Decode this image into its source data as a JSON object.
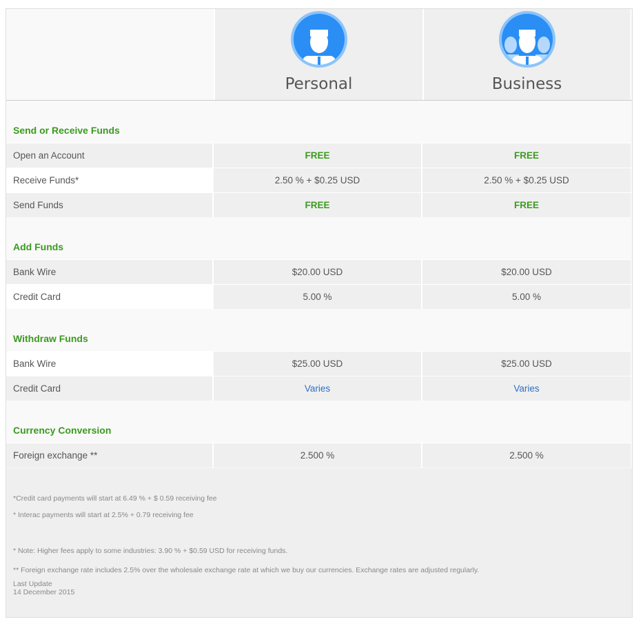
{
  "plans": [
    {
      "name": "Personal",
      "icon": "person-icon"
    },
    {
      "name": "Business",
      "icon": "group-icon"
    }
  ],
  "colors": {
    "accent_green": "#3a9a1e",
    "icon_blue": "#2a8ef5",
    "link_blue": "#2e6fc4"
  },
  "sections": [
    {
      "title": "Send or Receive Funds",
      "rows": [
        {
          "label": "Open an Account",
          "personal": "FREE",
          "business": "FREE"
        },
        {
          "label": "Receive Funds*",
          "personal": "2.50 % + $0.25 USD",
          "business": "2.50 % + $0.25 USD"
        },
        {
          "label": "Send Funds",
          "personal": "FREE",
          "business": "FREE"
        }
      ]
    },
    {
      "title": "Add Funds",
      "rows": [
        {
          "label": "Bank Wire",
          "personal": "$20.00 USD",
          "business": "$20.00 USD"
        },
        {
          "label": "Credit Card",
          "personal": "5.00 %",
          "business": "5.00 %"
        }
      ]
    },
    {
      "title": "Withdraw Funds",
      "rows": [
        {
          "label": "Bank Wire",
          "personal": "$25.00 USD",
          "business": "$25.00 USD"
        },
        {
          "label": "Credit Card",
          "personal": "Varies",
          "business": "Varies"
        }
      ]
    },
    {
      "title": "Currency Conversion",
      "rows": [
        {
          "label": "Foreign exchange **",
          "personal": "2.500 %",
          "business": "2.500 %"
        }
      ]
    }
  ],
  "footnotes": {
    "credit_card": "*Credit card payments will start at 6.49 % + $ 0.59 receiving fee",
    "interac": "* Interac payments will start at 2.5% + 0.79 receiving fee",
    "note": "* Note: Higher fees apply to some industries: 3.90 % + $0.59 USD for receiving funds.",
    "fx": "** Foreign exchange rate includes 2.5% over the wholesale exchange rate at which we buy our currencies. Exchange rates are adjusted regularly.",
    "last_update_label": "Last Update",
    "last_update_date": "14 December 2015"
  }
}
